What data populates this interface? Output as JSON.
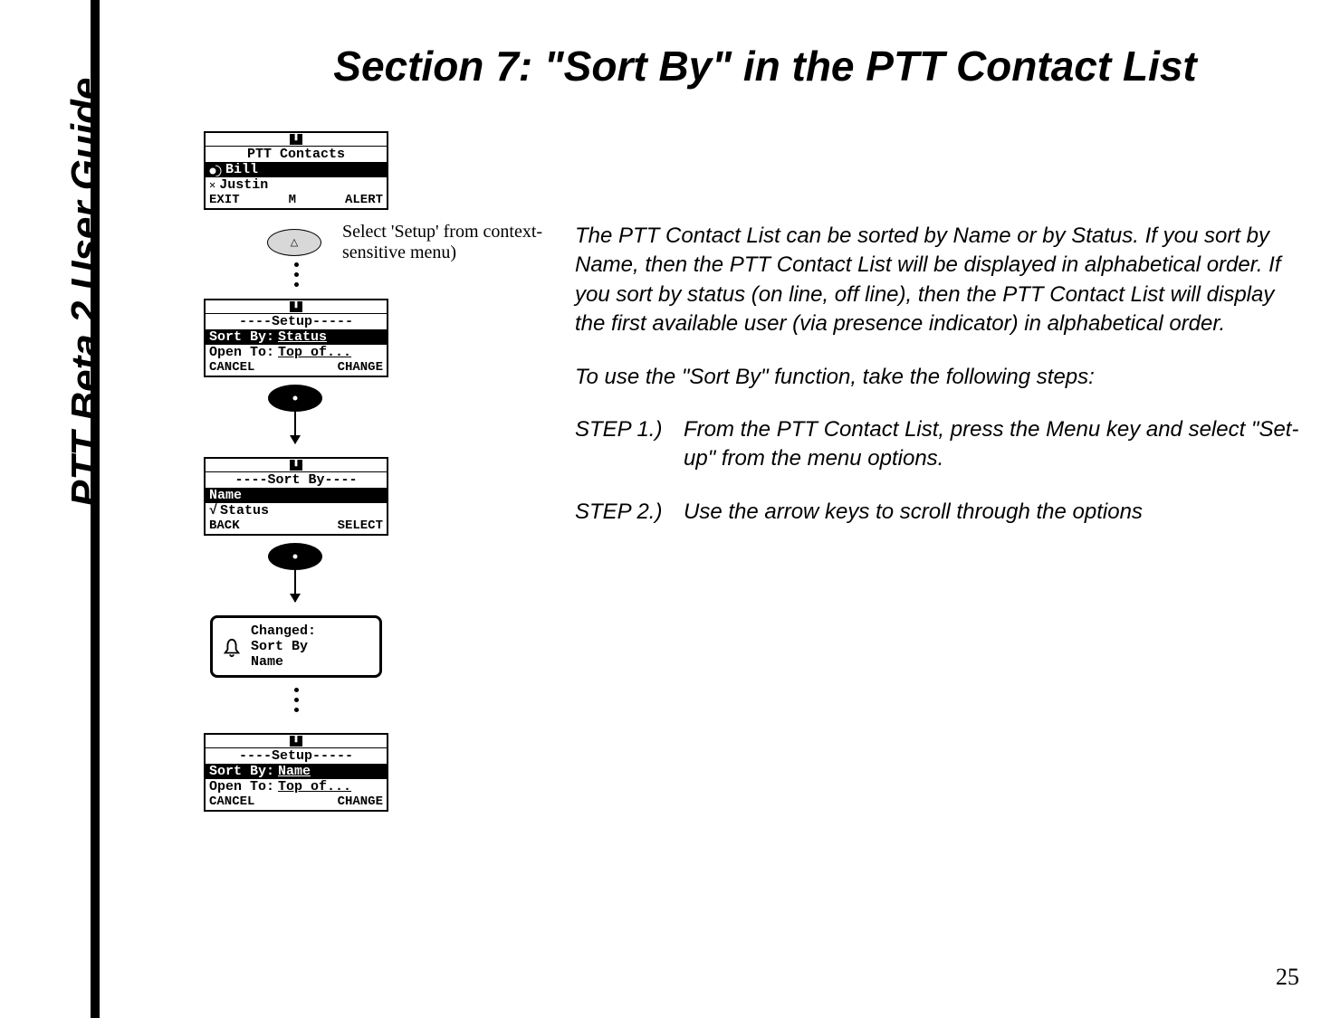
{
  "sidebar_title": "PTT Beta 2 User Guide",
  "page_title": "Section 7: \"Sort By\" in the PTT Contact List",
  "body": {
    "para1": "The PTT Contact List can be sorted by Name or by Status.  If you sort by Name, then the PTT Contact List will be displayed in alphabetical order.  If you sort by status (on line, off line), then the PTT Contact List will display the first available user (via presence indicator) in alphabetical order.",
    "para2": "To use the \"Sort By\" function, take the following steps:",
    "step1_label": "STEP 1.)",
    "step1_body": "From the PTT Contact List, press the Menu key and select \"Set-up\" from the menu options.",
    "step2_label": "STEP 2.)",
    "step2_body": "Use the arrow keys to scroll through the options"
  },
  "page_number": "25",
  "caption1": "Select 'Setup' from context-sensitive menu)",
  "screens": {
    "contacts": {
      "title": "PTT Contacts",
      "item1": "Bill",
      "item2": "Justin",
      "sk_left": "EXIT",
      "sk_mid": "M",
      "sk_right": "ALERT"
    },
    "setup1": {
      "title": "----Setup-----",
      "line1a": "Sort By:",
      "line1b": "Status",
      "line2a": "Open To:",
      "line2b": "Top of...",
      "sk_left": "CANCEL",
      "sk_right": "CHANGE"
    },
    "sortby": {
      "title": "----Sort By----",
      "opt1": "Name",
      "opt2": "Status",
      "sk_left": "BACK",
      "sk_right": "SELECT"
    },
    "changed": {
      "l1": "Changed:",
      "l2": "Sort By",
      "l3": "Name"
    },
    "setup2": {
      "title": "----Setup-----",
      "line1a": "Sort By:",
      "line1b": "Name   ",
      "line2a": "Open To:",
      "line2b": "Top of...",
      "sk_left": "CANCEL",
      "sk_right": "CHANGE"
    }
  }
}
